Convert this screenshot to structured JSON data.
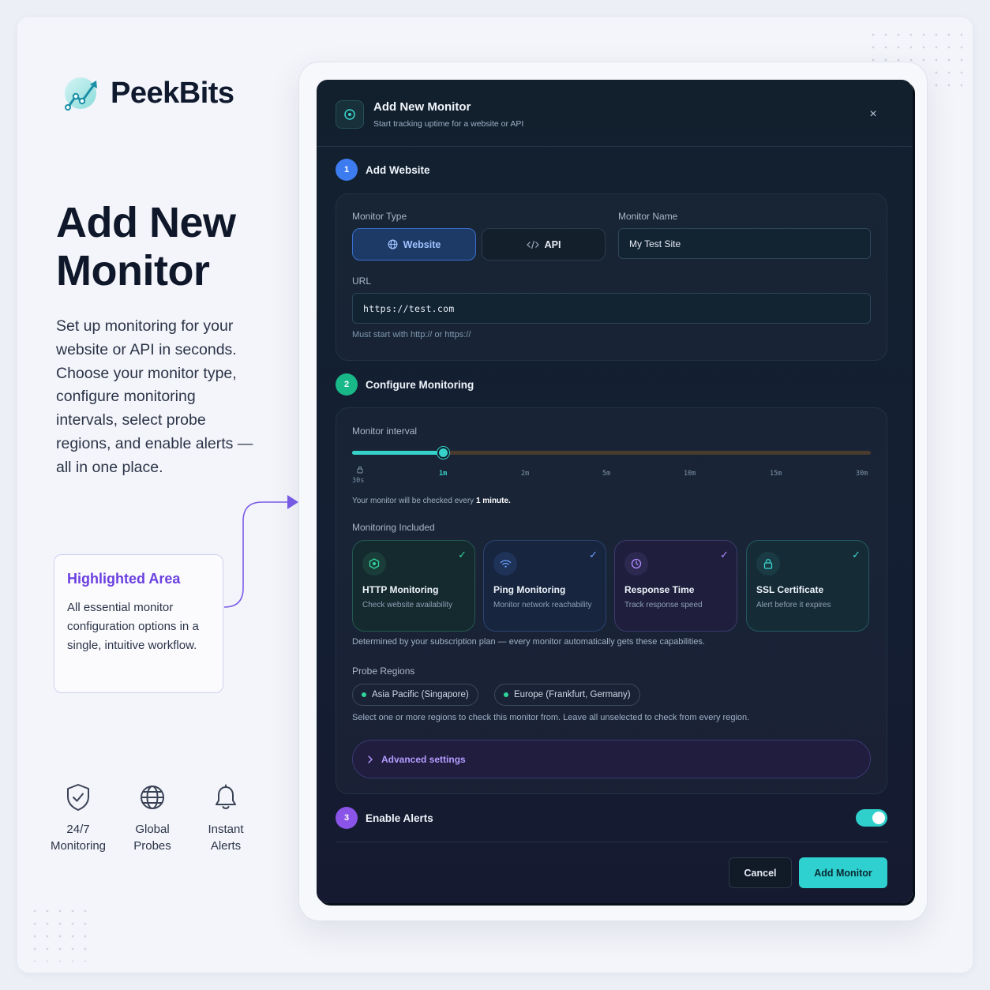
{
  "brand": {
    "name": "PeekBits"
  },
  "hero": {
    "title": "Add New Monitor",
    "description": "Set up monitoring for your website or API in seconds. Choose your monitor type, configure monitoring intervals, select probe regions, and enable alerts — all in one place."
  },
  "callout": {
    "title": "Highlighted Area",
    "text": "All essential monitor configuration options in a single, intuitive workflow."
  },
  "features": [
    {
      "line1": "24/7",
      "line2": "Monitoring",
      "icon": "shield-check-icon"
    },
    {
      "line1": "Global",
      "line2": "Probes",
      "icon": "globe-icon"
    },
    {
      "line1": "Instant",
      "line2": "Alerts",
      "icon": "bell-icon"
    }
  ],
  "modal": {
    "title": "Add New Monitor",
    "subtitle": "Start tracking uptime for a website or API",
    "close_label": "×",
    "steps": [
      {
        "num": "1",
        "label": "Add Website",
        "color": "#3d7cf0"
      },
      {
        "num": "2",
        "label": "Configure Monitoring",
        "color": "#18b888"
      },
      {
        "num": "3",
        "label": "Enable Alerts",
        "color": "#8b54e8"
      }
    ],
    "monitor_type": {
      "label": "Monitor Type",
      "options": [
        "Website",
        "API"
      ],
      "selected": "Website"
    },
    "monitor_name": {
      "label": "Monitor Name",
      "value": "My Test Site"
    },
    "url": {
      "label": "URL",
      "value": "https://test.com",
      "hint": "Must start with http:// or https://"
    },
    "interval": {
      "label": "Monitor interval",
      "ticks": [
        "30s",
        "1m",
        "2m",
        "5m",
        "10m",
        "15m",
        "30m"
      ],
      "selected": "1m",
      "selected_fraction": 0.175,
      "summary_prefix": "Your monitor will be checked every",
      "summary_value": "1 minute."
    },
    "included": {
      "label": "Monitoring Included",
      "cards": [
        {
          "title": "HTTP Monitoring",
          "desc": "Check website availability",
          "icon": "http-monitor-icon",
          "accent": "#2fd49a"
        },
        {
          "title": "Ping Monitoring",
          "desc": "Monitor network reachability",
          "icon": "wifi-icon",
          "accent": "#6aa2ff"
        },
        {
          "title": "Response Time",
          "desc": "Track response speed",
          "icon": "clock-icon",
          "accent": "#b08cff"
        },
        {
          "title": "SSL Certificate",
          "desc": "Alert before it expires",
          "icon": "lock-icon",
          "accent": "#3ad6d0"
        }
      ],
      "note": "Determined by your subscription plan — every monitor automatically gets these capabilities."
    },
    "probe_regions": {
      "label": "Probe Regions",
      "chips": [
        "Asia Pacific (Singapore)",
        "Europe (Frankfurt, Germany)"
      ],
      "hint": "Select one or more regions to check this monitor from. Leave all unselected to check from every region."
    },
    "advanced": {
      "label": "Advanced settings"
    },
    "alerts": {
      "enabled": true
    },
    "buttons": {
      "cancel": "Cancel",
      "submit": "Add Monitor"
    }
  }
}
